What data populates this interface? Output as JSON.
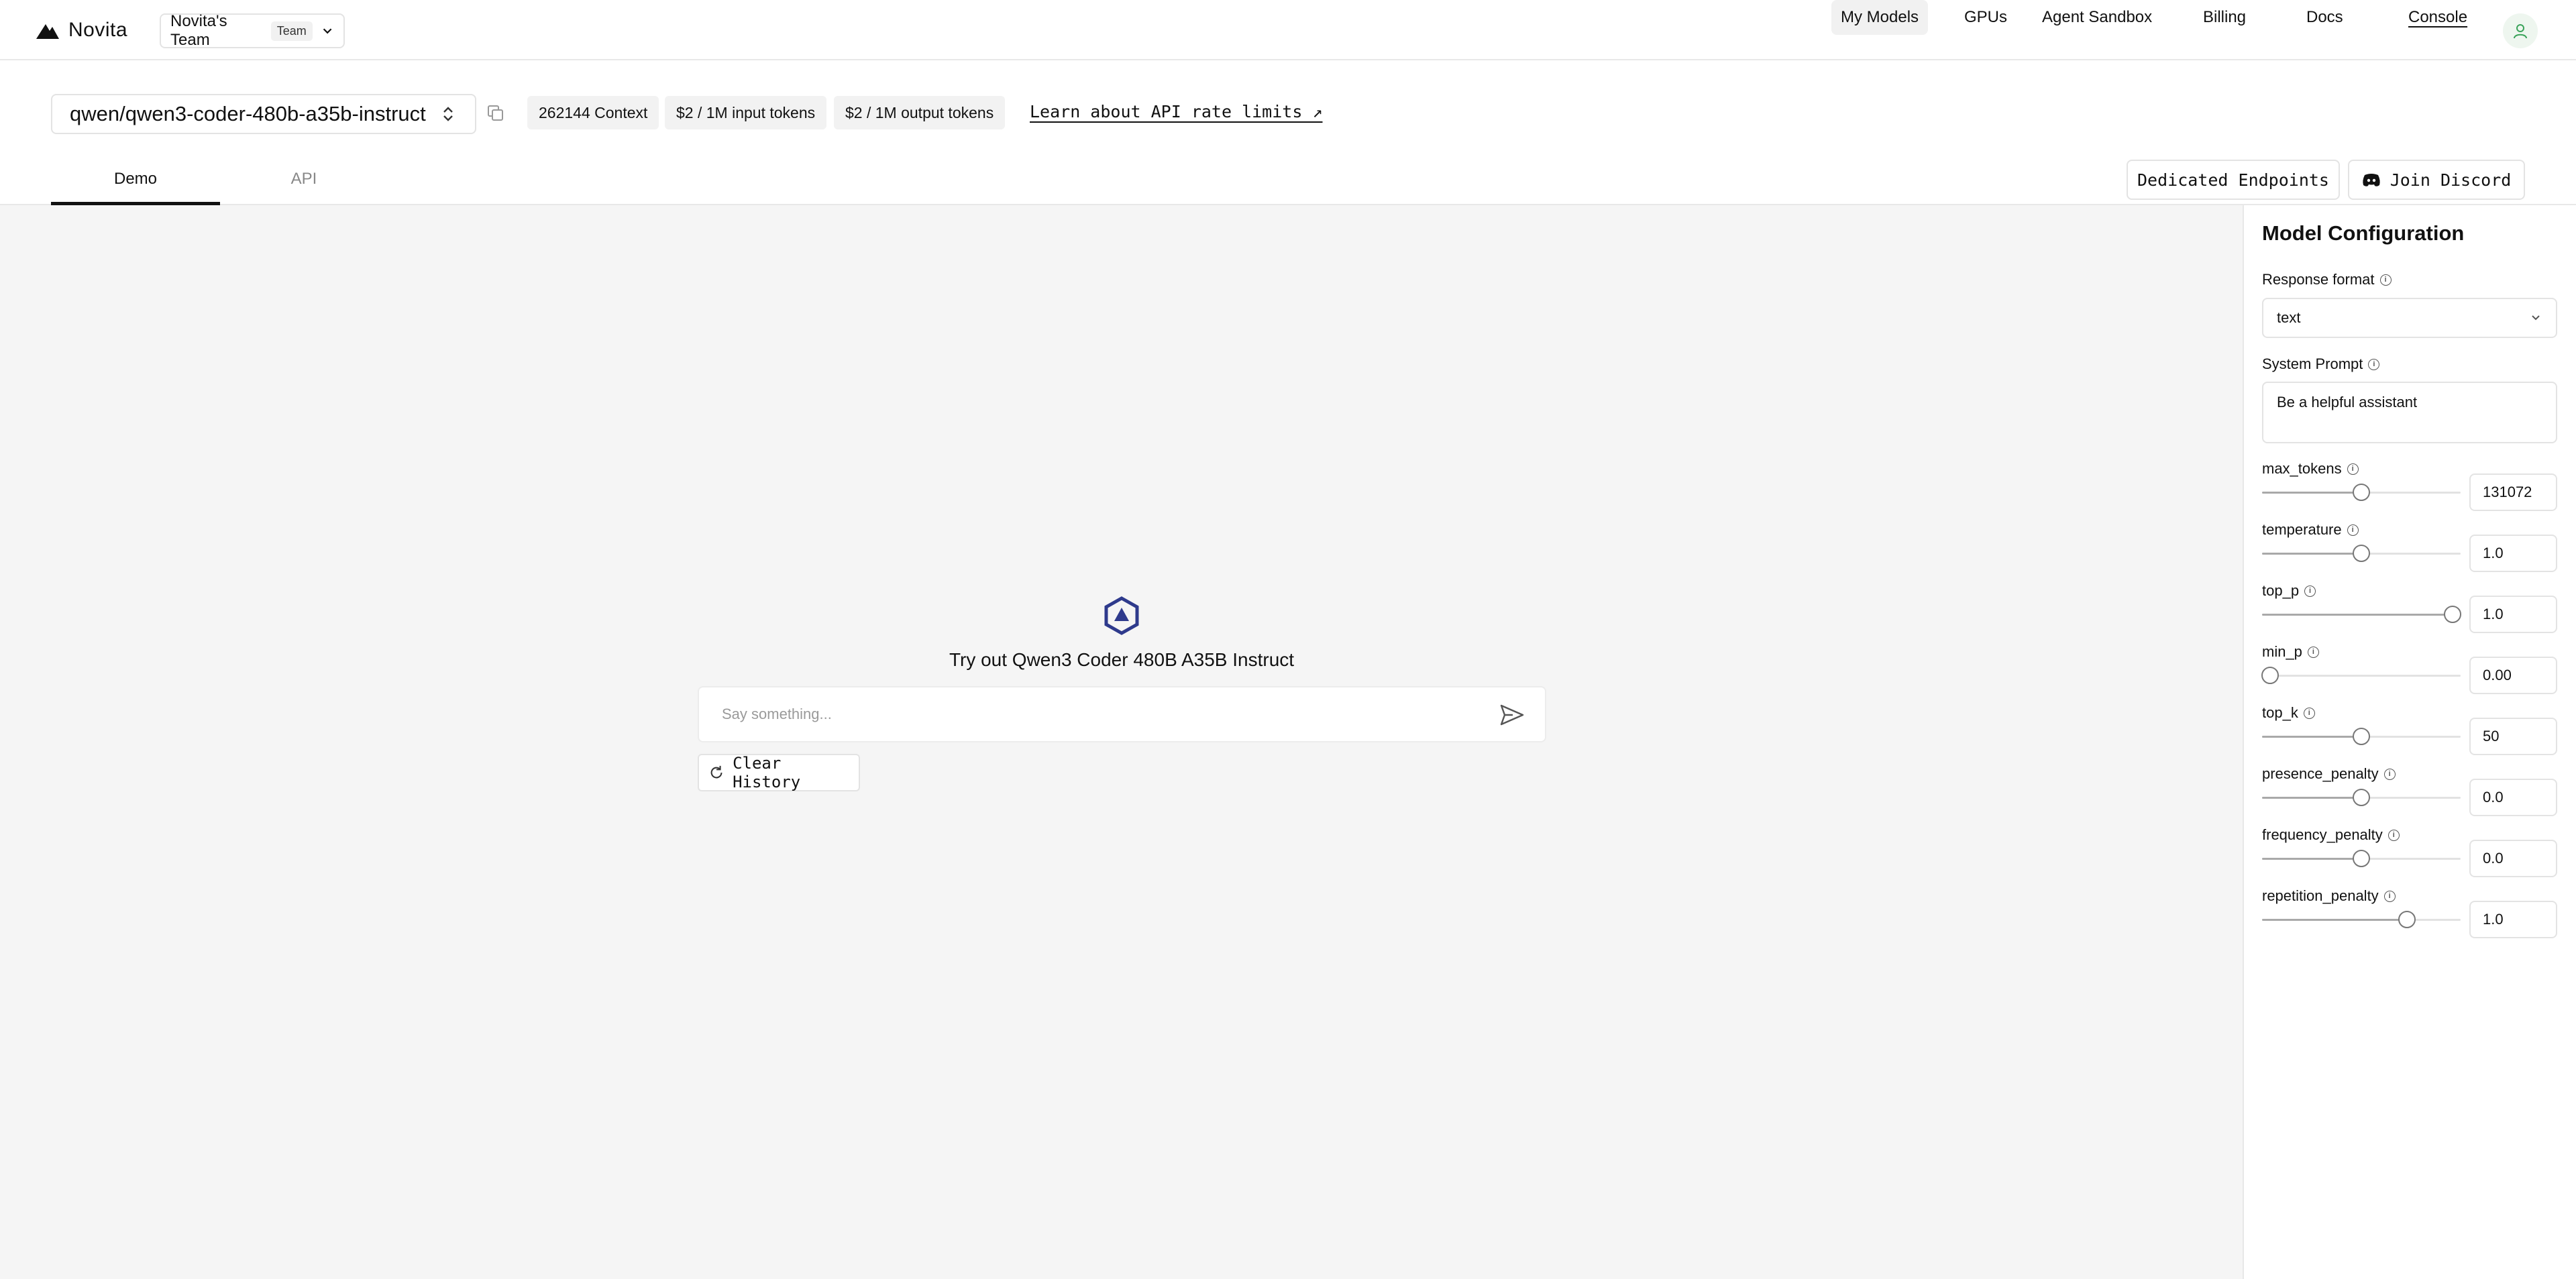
{
  "nav": {
    "brand": "Novita",
    "team_name": "Novita's Team",
    "team_badge": "Team",
    "links": [
      {
        "label": "My Models",
        "active": true
      },
      {
        "label": "GPUs",
        "active": false
      },
      {
        "label": "Agent Sandbox",
        "active": false
      },
      {
        "label": "Billing",
        "active": false
      },
      {
        "label": "Docs",
        "active": false
      },
      {
        "label": "Console",
        "active": false
      }
    ]
  },
  "model": {
    "name": "qwen/qwen3-coder-480b-a35b-instruct",
    "pills": [
      "262144 Context",
      "$2 / 1M input tokens",
      "$2 / 1M output tokens"
    ],
    "rate_link": "Learn about API rate limits ↗"
  },
  "tabs": [
    {
      "label": "Demo",
      "active": true
    },
    {
      "label": "API",
      "active": false
    }
  ],
  "actions": {
    "dedicated": "Dedicated Endpoints",
    "discord": "Join Discord"
  },
  "demo": {
    "title": "Try out Qwen3 Coder 480B A35B Instruct",
    "placeholder": "Say something...",
    "clear_label": "Clear History"
  },
  "config": {
    "title": "Model Configuration",
    "response_format_label": "Response format",
    "response_format_value": "text",
    "system_prompt_label": "System Prompt",
    "system_prompt_value": "Be a helpful assistant",
    "params": [
      {
        "name": "max_tokens",
        "value": "131072",
        "fraction": 0.5
      },
      {
        "name": "temperature",
        "value": "1.0",
        "fraction": 0.5
      },
      {
        "name": "top_p",
        "value": "1.0",
        "fraction": 0.96
      },
      {
        "name": "min_p",
        "value": "0.00",
        "fraction": 0.04
      },
      {
        "name": "top_k",
        "value": "50",
        "fraction": 0.5
      },
      {
        "name": "presence_penalty",
        "value": "0.0",
        "fraction": 0.5
      },
      {
        "name": "frequency_penalty",
        "value": "0.0",
        "fraction": 0.5
      },
      {
        "name": "repetition_penalty",
        "value": "1.0",
        "fraction": 0.73
      }
    ]
  }
}
